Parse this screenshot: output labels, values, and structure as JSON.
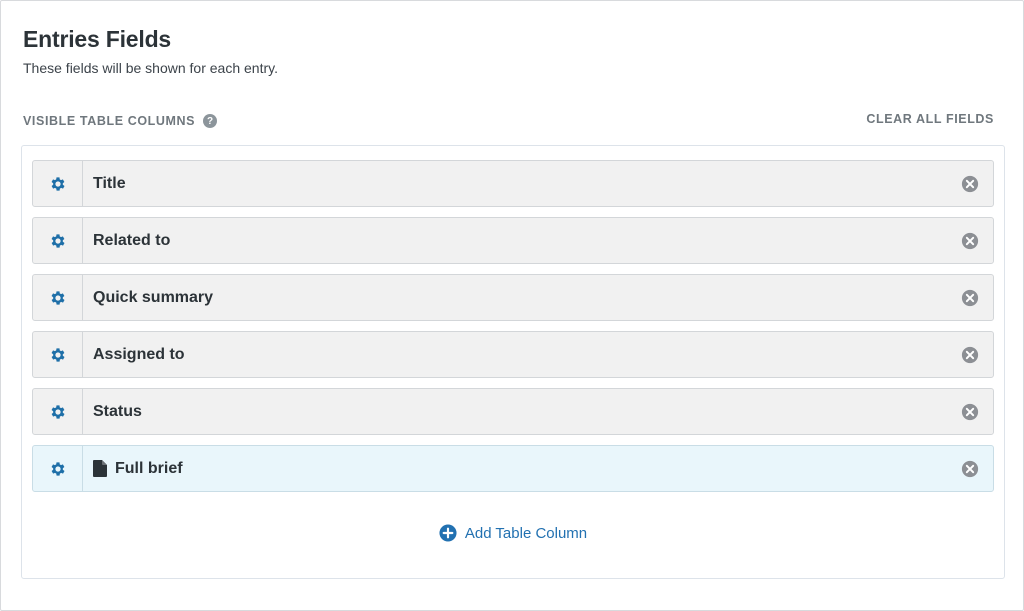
{
  "header": {
    "title": "Entries Fields",
    "subtitle": "These fields will be shown for each entry."
  },
  "section": {
    "label": "VISIBLE TABLE COLUMNS",
    "help_icon": "question-circle-icon",
    "clear_label": "CLEAR ALL FIELDS"
  },
  "columns": [
    {
      "label": "Title",
      "icon": "gear-icon"
    },
    {
      "label": "Related to",
      "icon": "gear-icon"
    },
    {
      "label": "Quick summary",
      "icon": "gear-icon"
    },
    {
      "label": "Assigned to",
      "icon": "gear-icon"
    },
    {
      "label": "Status",
      "icon": "gear-icon"
    },
    {
      "label": "Full brief",
      "icon": "gear-icon",
      "type_icon": "document-icon",
      "highlighted": true
    }
  ],
  "add_column": {
    "label": "Add Table Column",
    "icon": "plus-circle-icon"
  },
  "colors": {
    "accent": "#2271b1",
    "gear": "#1e6fa8",
    "remove": "#8c8f94",
    "highlight_bg": "#e9f6fb"
  }
}
